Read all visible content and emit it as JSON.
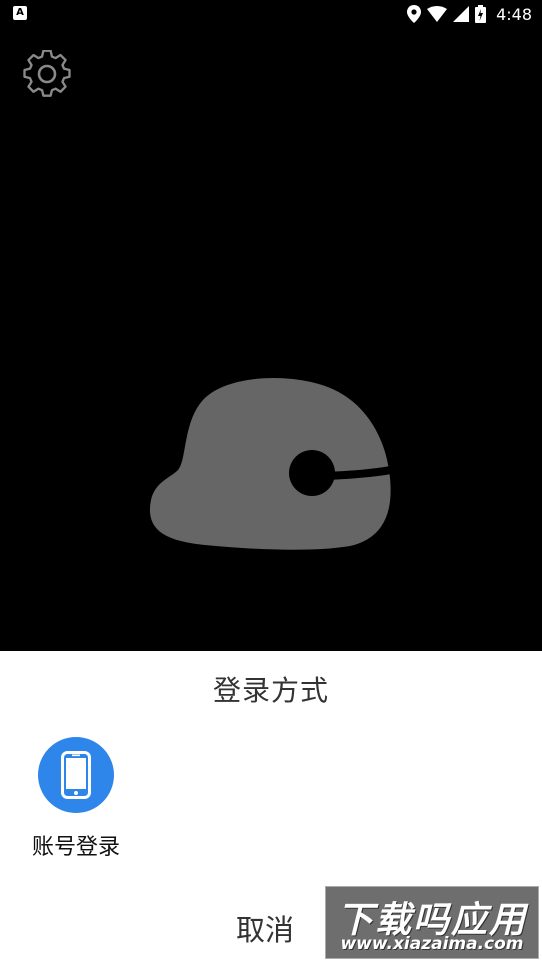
{
  "status_bar": {
    "time": "4:48",
    "left_icon": "A",
    "icons": [
      "location-icon",
      "wifi-icon",
      "signal-icon",
      "battery-charging-icon"
    ]
  },
  "settings": {
    "icon": "gear-icon"
  },
  "mascot": {
    "icon": "app-logo-mascot"
  },
  "sheet": {
    "title": "登录方式",
    "options": [
      {
        "label": "账号登录",
        "icon": "phone-icon",
        "color": "#2f86ea"
      }
    ],
    "cancel_label": "取消"
  },
  "watermark": {
    "title": "下载吗应用",
    "url": "www.xiazaima.com"
  }
}
